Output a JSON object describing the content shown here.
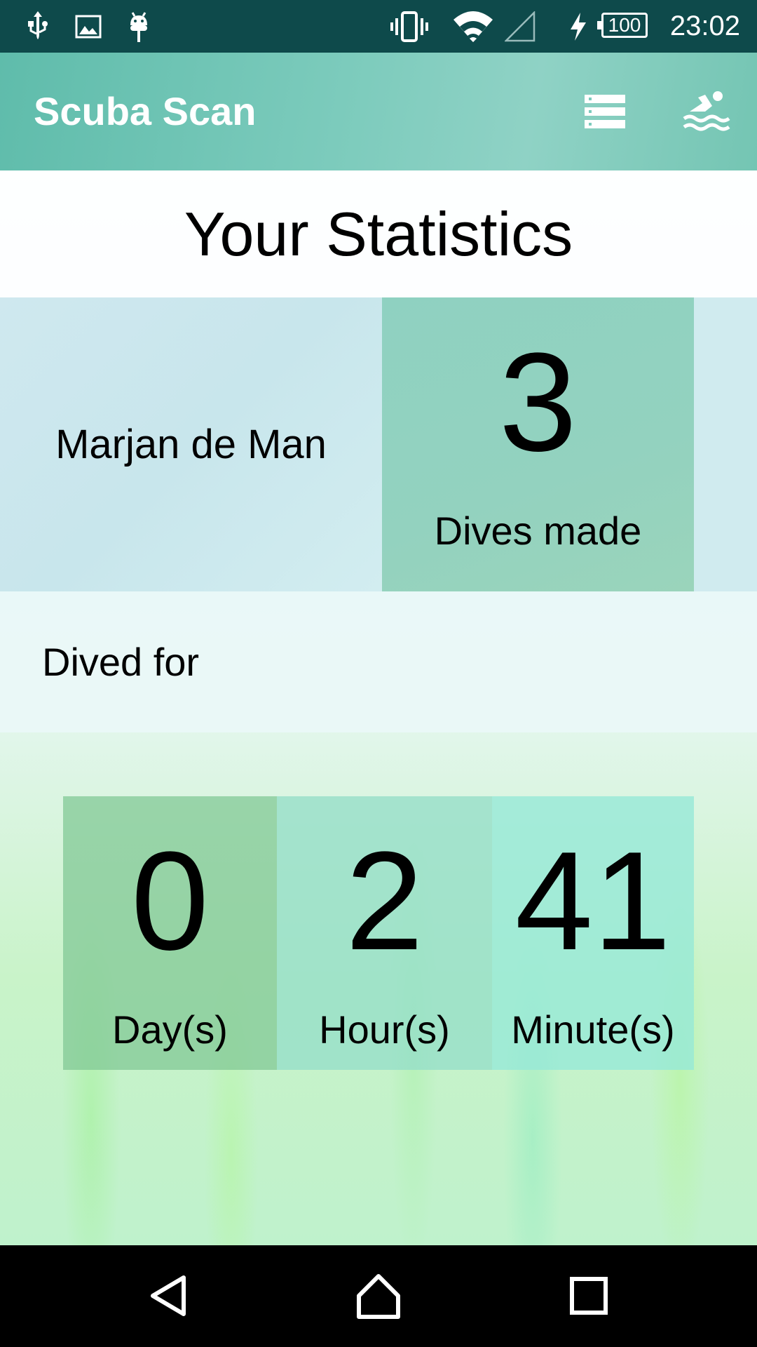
{
  "status_bar": {
    "time": "23:02",
    "battery_level": "100",
    "icons": [
      "usb-icon",
      "image-icon",
      "android-debug-icon",
      "vibrate-icon",
      "wifi-icon",
      "signal-icon",
      "charging-icon"
    ]
  },
  "app_bar": {
    "title": "Scuba Scan",
    "actions": [
      "list-icon",
      "swimmer-icon"
    ],
    "accent_color": "#6cc2b1"
  },
  "stats": {
    "heading": "Your Statistics",
    "diver_name": "Marjan de Man",
    "dives_count": "3",
    "dives_label": "Dives made",
    "dived_for_label": "Dived for",
    "duration": {
      "days": "0",
      "days_label": "Day(s)",
      "hours": "2",
      "hours_label": "Hour(s)",
      "minutes": "41",
      "minutes_label": "Minute(s)"
    }
  },
  "nav_bar": {
    "buttons": [
      "back-icon",
      "home-icon",
      "recents-icon"
    ]
  }
}
